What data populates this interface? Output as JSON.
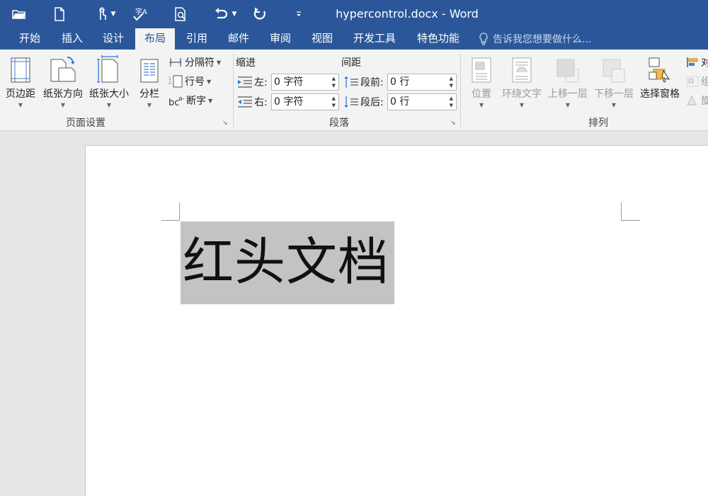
{
  "window": {
    "title": "hypercontrol.docx - Word"
  },
  "quick_access": [
    {
      "name": "open-icon"
    },
    {
      "name": "new-document-icon"
    },
    {
      "name": "touch-mode-icon"
    },
    {
      "name": "spelling-check-icon"
    },
    {
      "name": "print-preview-icon"
    },
    {
      "name": "undo-icon"
    },
    {
      "name": "redo-icon"
    },
    {
      "name": "customize-toolbar-icon"
    }
  ],
  "tabs": [
    "开始",
    "插入",
    "设计",
    "布局",
    "引用",
    "邮件",
    "审阅",
    "视图",
    "开发工具",
    "特色功能"
  ],
  "active_tab": "布局",
  "tell_me": "告诉我您想要做什么...",
  "page_setup": {
    "margins": "页边距",
    "orientation": "纸张方向",
    "size": "纸张大小",
    "columns": "分栏",
    "breaks": "分隔符",
    "line_numbers": "行号",
    "hyphenation": "断字",
    "group_label": "页面设置"
  },
  "paragraph": {
    "indent_header": "缩进",
    "spacing_header": "间距",
    "left_label": "左:",
    "left_value": "0 字符",
    "right_label": "右:",
    "right_value": "0 字符",
    "before_label": "段前:",
    "before_value": "0 行",
    "after_label": "段后:",
    "after_value": "0 行",
    "group_label": "段落"
  },
  "arrange": {
    "position": "位置",
    "wrap_text": "环绕文字",
    "bring_forward": "上移一层",
    "send_backward": "下移一层",
    "selection_pane": "选择窗格",
    "align_partial": "对",
    "group_partial": "组",
    "rotate_partial": "旋",
    "group_label": "排列"
  },
  "document": {
    "heading": "红头文档",
    "selection_color": "#c3c3c3"
  },
  "colors": {
    "accent": "#2b579a",
    "ribbon": "#f3f3f3",
    "workspace": "#e6e6e6"
  }
}
